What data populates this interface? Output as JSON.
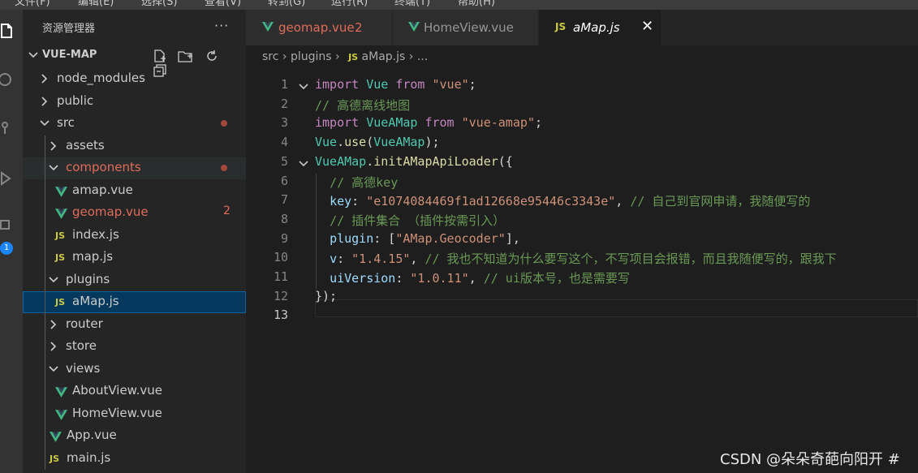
{
  "topstrip": [
    "文件(F)",
    "编辑(E)",
    "选择(S)",
    "查看(V)",
    "转到(G)",
    "运行(R)",
    "终端(T)",
    "帮助(H)"
  ],
  "activity": {
    "badge": "1"
  },
  "sidebar": {
    "title": "资源管理器",
    "more": "···",
    "project": "VUE-MAP",
    "tree": [
      {
        "label": "node_modules",
        "kind": "folder",
        "open": false
      },
      {
        "label": "public",
        "kind": "folder",
        "open": false
      },
      {
        "label": "src",
        "kind": "folder",
        "open": true
      },
      {
        "label": "assets",
        "kind": "folder",
        "open": false
      },
      {
        "label": "components",
        "kind": "folder",
        "open": true
      },
      {
        "label": "amap.vue",
        "kind": "vue"
      },
      {
        "label": "geomap.vue",
        "kind": "vue",
        "errors": "2"
      },
      {
        "label": "index.js",
        "kind": "js"
      },
      {
        "label": "map.js",
        "kind": "js"
      },
      {
        "label": "plugins",
        "kind": "folder",
        "open": true
      },
      {
        "label": "aMap.js",
        "kind": "js"
      },
      {
        "label": "router",
        "kind": "folder",
        "open": false
      },
      {
        "label": "store",
        "kind": "folder",
        "open": false
      },
      {
        "label": "views",
        "kind": "folder",
        "open": true
      },
      {
        "label": "AboutView.vue",
        "kind": "vue"
      },
      {
        "label": "HomeView.vue",
        "kind": "vue"
      },
      {
        "label": "App.vue",
        "kind": "vue"
      },
      {
        "label": "main.js",
        "kind": "js"
      }
    ]
  },
  "tabs": [
    {
      "label": "geomap.vue",
      "badge": "2"
    },
    {
      "label": "HomeView.vue"
    },
    {
      "label": "aMap.js",
      "icon": "JS",
      "close": "✕"
    }
  ],
  "breadcrumb": {
    "parts": [
      "src",
      "plugins",
      "aMap.js",
      "..."
    ],
    "sep": "›",
    "js": "JS"
  },
  "code": {
    "line_numbers": [
      "1",
      "2",
      "3",
      "4",
      "5",
      "6",
      "7",
      "8",
      "9",
      "10",
      "11",
      "12",
      "13"
    ],
    "lines": [
      [
        [
          "k",
          "import"
        ],
        [
          "d",
          " "
        ],
        [
          "v",
          "Vue"
        ],
        [
          "d",
          " "
        ],
        [
          "k",
          "from"
        ],
        [
          "d",
          " "
        ],
        [
          "s",
          "\"vue\""
        ],
        [
          "d",
          ";"
        ]
      ],
      [
        [
          "c",
          "// 高德离线地图"
        ]
      ],
      [
        [
          "k",
          "import"
        ],
        [
          "d",
          " "
        ],
        [
          "v",
          "VueAMap"
        ],
        [
          "d",
          " "
        ],
        [
          "k",
          "from"
        ],
        [
          "d",
          " "
        ],
        [
          "s",
          "\"vue-amap\""
        ],
        [
          "d",
          ";"
        ]
      ],
      [
        [
          "v",
          "Vue"
        ],
        [
          "d",
          "."
        ],
        [
          "f",
          "use"
        ],
        [
          "d",
          "("
        ],
        [
          "v",
          "VueAMap"
        ],
        [
          "d",
          ");"
        ]
      ],
      [
        [
          "v",
          "VueAMap"
        ],
        [
          "d",
          "."
        ],
        [
          "f",
          "initAMapApiLoader"
        ],
        [
          "d",
          "({"
        ]
      ],
      [
        [
          "d",
          "  "
        ],
        [
          "c",
          "// 高德key"
        ]
      ],
      [
        [
          "d",
          "  "
        ],
        [
          "p",
          "key"
        ],
        [
          "d",
          ": "
        ],
        [
          "s",
          "\"e1074084469f1ad12668e95446c3343e\""
        ],
        [
          "d",
          ", "
        ],
        [
          "c",
          "// 自己到官网申请，我随便写的"
        ]
      ],
      [
        [
          "d",
          "  "
        ],
        [
          "c",
          "// 插件集合 （插件按需引入）"
        ]
      ],
      [
        [
          "d",
          "  "
        ],
        [
          "p",
          "plugin"
        ],
        [
          "d",
          ": ["
        ],
        [
          "s",
          "\"AMap.Geocoder\""
        ],
        [
          "d",
          "],"
        ]
      ],
      [
        [
          "d",
          "  "
        ],
        [
          "p",
          "v"
        ],
        [
          "d",
          ": "
        ],
        [
          "s",
          "\"1.4.15\""
        ],
        [
          "d",
          ", "
        ],
        [
          "c",
          "// 我也不知道为什么要写这个，不写项目会报错，而且我随便写的，跟我下"
        ]
      ],
      [
        [
          "d",
          "  "
        ],
        [
          "p",
          "uiVersion"
        ],
        [
          "d",
          ": "
        ],
        [
          "s",
          "\"1.0.11\""
        ],
        [
          "d",
          ", "
        ],
        [
          "c",
          "// ui版本号，也是需要写"
        ]
      ],
      [
        [
          "d",
          "});"
        ]
      ],
      []
    ]
  },
  "watermark": "CSDN @朵朵奇葩向阳开 #",
  "colors": {
    "vue": "#42b883",
    "js": "#cbcb41",
    "error": "#e06c5a",
    "selection": "#04395e"
  }
}
